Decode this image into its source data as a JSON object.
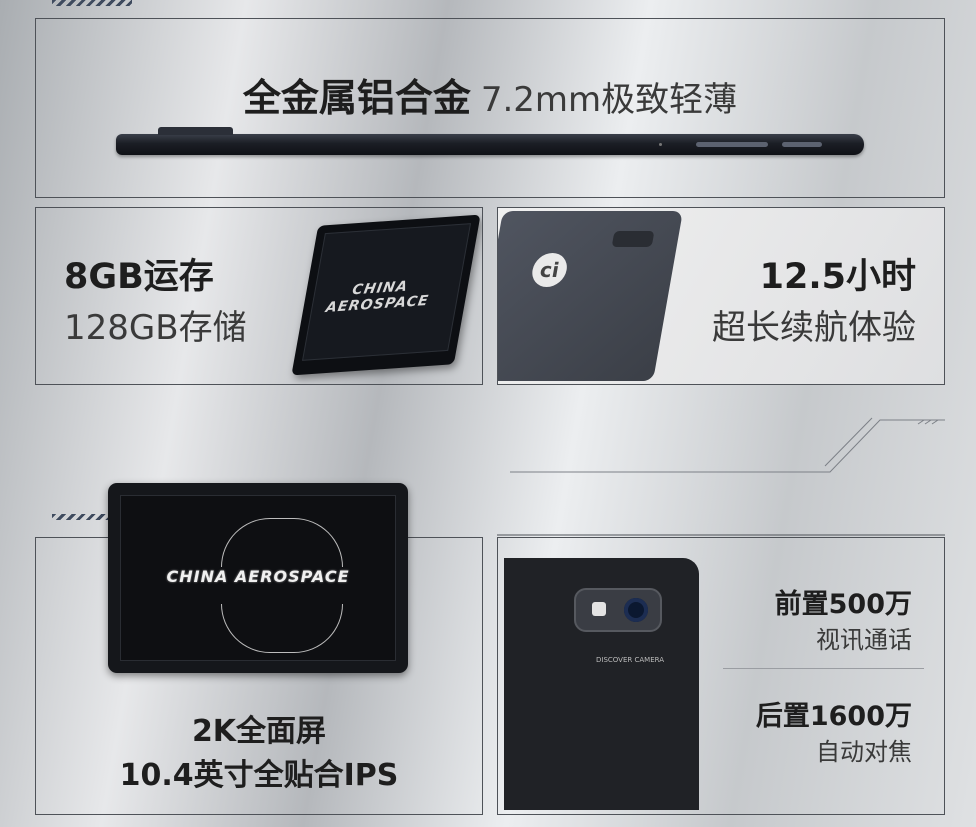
{
  "panel_metal": {
    "title_bold": "全金属铝合金",
    "title_light": "7.2mm极致轻薄"
  },
  "panel_memory": {
    "line1": "8GB运存",
    "line2": "128GB存储",
    "screen_text": "CHINA AEROSPACE"
  },
  "panel_battery": {
    "line1": "12.5小时",
    "line2": "超长续航体验",
    "logo_text": "ci"
  },
  "panel_display": {
    "line1": "2K全面屏",
    "line2": "10.4英寸全贴合IPS",
    "screen_text": "CHINA AEROSPACE"
  },
  "panel_camera": {
    "front_title": "前置500万",
    "front_sub": "视讯通话",
    "rear_title": "后置1600万",
    "rear_sub": "自动对焦",
    "lens_label": "DISCOVER CAMERA"
  }
}
